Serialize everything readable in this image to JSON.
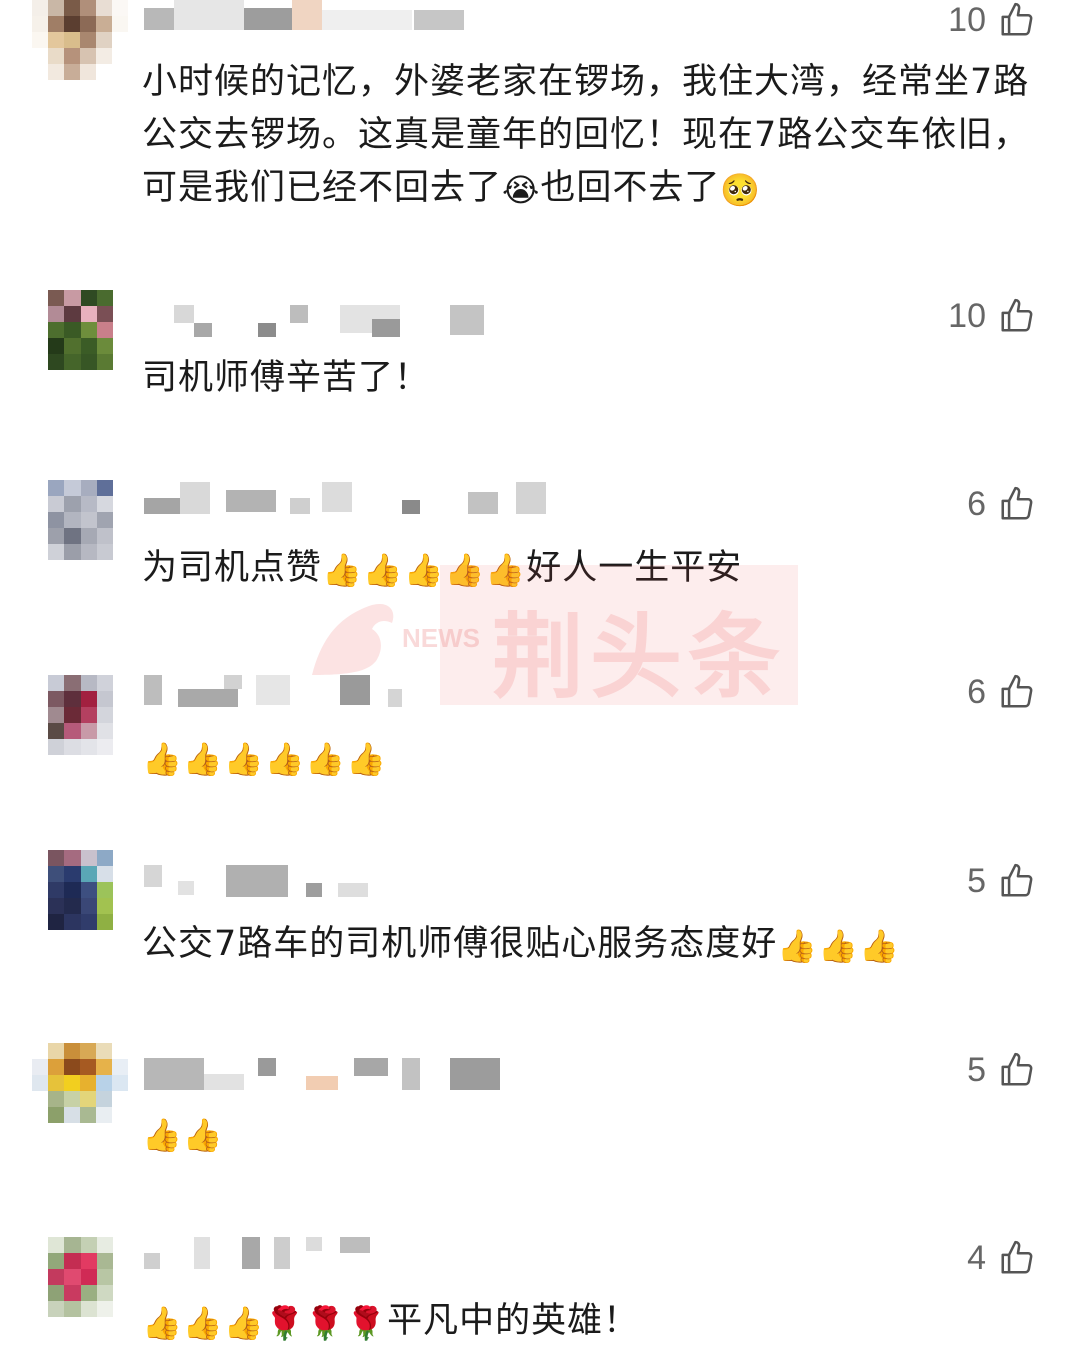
{
  "comments": [
    {
      "likes": "10",
      "text": "小时候的记忆，外婆老家在锣场，我住大湾，经常坐7路公交去锣场。这真是童年的回忆！现在7路公交车依旧，可是我们已经不回去了",
      "emojis": [
        "😭",
        "🥺"
      ],
      "trailing": "也回不去了"
    },
    {
      "likes": "10",
      "text": "司机师傅辛苦了！"
    },
    {
      "likes": "6",
      "text": "为司机点赞",
      "thumbs": "👍👍👍👍👍",
      "tail": "好人一生平安"
    },
    {
      "likes": "6",
      "thumbs": "👍👍👍👍👍👍"
    },
    {
      "likes": "5",
      "text": "公交7路车的司机师傅很贴心服务态度好",
      "thumbs": "👍👍👍"
    },
    {
      "likes": "5",
      "thumbs": "👍👍"
    },
    {
      "likes": "4",
      "thumbs": "👍👍👍",
      "roses": "🌹🌹🌹",
      "tail": "平凡中的英雄！"
    }
  ],
  "watermark": {
    "brand": "荆头条",
    "tag": "NEWS"
  },
  "icons": {
    "like": "thumbs-up-outline-icon"
  },
  "colors": {
    "text": "#1b1b1b",
    "count": "#666666",
    "watermark": "#f05050"
  }
}
